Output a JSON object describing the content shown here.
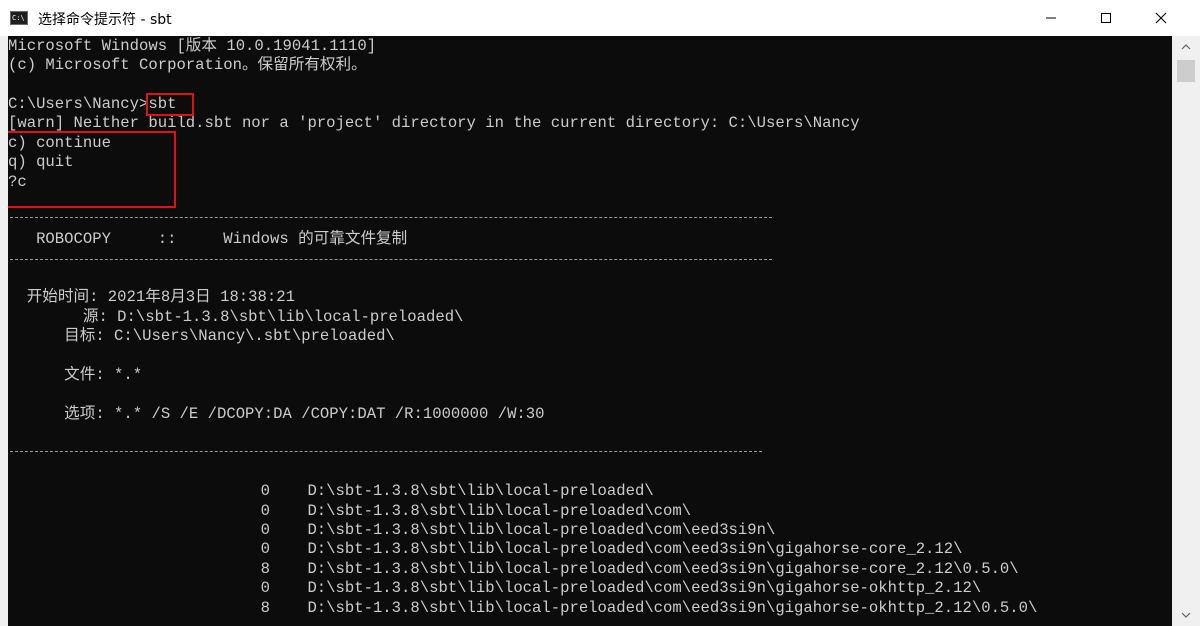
{
  "window": {
    "icon_text": "C:\\",
    "title": "选择命令提示符 - sbt"
  },
  "console": {
    "lines": [
      "Microsoft Windows [版本 10.0.19041.1110]",
      "(c) Microsoft Corporation。保留所有权利。",
      "",
      "C:\\Users\\Nancy>sbt",
      "[warn] Neither build.sbt nor a 'project' directory in the current directory: C:\\Users\\Nancy",
      "c) continue",
      "q) quit",
      "?c",
      "",
      "",
      "   ROBOCOPY     ::     Windows 的可靠文件复制",
      "",
      "",
      "",
      "  开始时间: 2021年8月3日 18:38:21",
      "        源: D:\\sbt-1.3.8\\sbt\\lib\\local-preloaded\\",
      "      目标: C:\\Users\\Nancy\\.sbt\\preloaded\\",
      "",
      "      文件: *.*",
      "",
      "      选项: *.* /S /E /DCOPY:DA /COPY:DAT /R:1000000 /W:30",
      "",
      "",
      "",
      "",
      "                           0    D:\\sbt-1.3.8\\sbt\\lib\\local-preloaded\\",
      "                           0    D:\\sbt-1.3.8\\sbt\\lib\\local-preloaded\\com\\",
      "                           0    D:\\sbt-1.3.8\\sbt\\lib\\local-preloaded\\com\\eed3si9n\\",
      "                           0    D:\\sbt-1.3.8\\sbt\\lib\\local-preloaded\\com\\eed3si9n\\gigahorse-core_2.12\\",
      "                           8    D:\\sbt-1.3.8\\sbt\\lib\\local-preloaded\\com\\eed3si9n\\gigahorse-core_2.12\\0.5.0\\",
      "                           0    D:\\sbt-1.3.8\\sbt\\lib\\local-preloaded\\com\\eed3si9n\\gigahorse-okhttp_2.12\\",
      "                           8    D:\\sbt-1.3.8\\sbt\\lib\\local-preloaded\\com\\eed3si9n\\gigahorse-okhttp_2.12\\0.5.0\\"
    ]
  }
}
